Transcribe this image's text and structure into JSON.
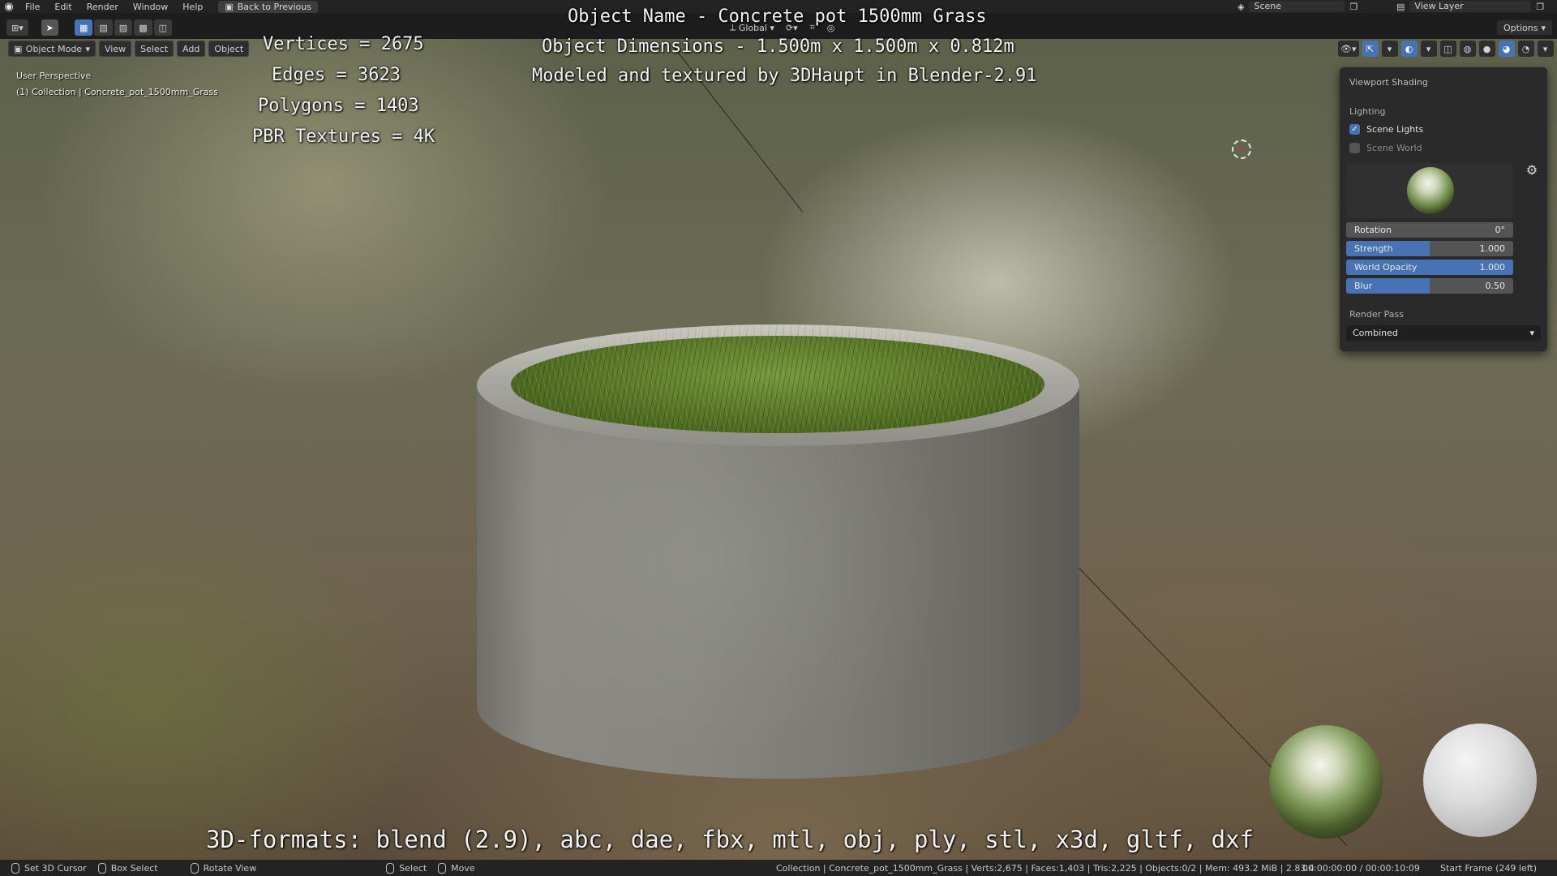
{
  "header": {
    "menu": [
      "File",
      "Edit",
      "Render",
      "Window",
      "Help"
    ],
    "back_button": "Back to Previous",
    "scene_label": "Scene",
    "view_layer_label": "View Layer",
    "options_label": "Options"
  },
  "viewport_header": {
    "mode": "Object Mode",
    "menus": [
      "View",
      "Select",
      "Add",
      "Object"
    ],
    "orientation": "Global"
  },
  "viewport": {
    "perspective": "User Perspective",
    "collection_info": "(1) Collection | Concrete_pot_1500mm_Grass"
  },
  "overlay": {
    "vertices": "Vertices = 2675",
    "edges": "Edges = 3623",
    "polygons": "Polygons = 1403",
    "textures": "PBR Textures = 4K",
    "object_name": "Object Name - Concrete pot 1500mm Grass",
    "dimensions": "Object Dimensions -  1.500m x 1.500m x 0.812m",
    "credits": "Modeled and textured by 3DHaupt in Blender-2.91",
    "formats": "3D-formats: blend (2.9), abc, dae, fbx, mtl, obj, ply, stl, x3d, gltf, dxf"
  },
  "shading_popover": {
    "title": "Viewport Shading",
    "lighting_label": "Lighting",
    "scene_lights": {
      "label": "Scene Lights",
      "checked": true
    },
    "scene_world": {
      "label": "Scene World",
      "checked": false
    },
    "rotation": {
      "label": "Rotation",
      "value": "0°",
      "fill": 0
    },
    "strength": {
      "label": "Strength",
      "value": "1.000",
      "fill": 0.5
    },
    "world_opacity": {
      "label": "World Opacity",
      "value": "1.000",
      "fill": 1
    },
    "blur": {
      "label": "Blur",
      "value": "0.50",
      "fill": 0.5
    },
    "render_pass_label": "Render Pass",
    "render_pass_value": "Combined"
  },
  "statusbar": {
    "set_cursor": "Set 3D Cursor",
    "box_select": "Box Select",
    "rotate_view": "Rotate View",
    "select": "Select",
    "move": "Move",
    "stats": "Collection | Concrete_pot_1500mm_Grass | Verts:2,675 | Faces:1,403 | Tris:2,225 | Objects:0/2 | Mem: 493.2 MiB | 2.83.4",
    "time": "00:00:00:00 / 00:00:10:09",
    "frame": "Start Frame (249 left)"
  },
  "colors": {
    "accent": "#4772b3",
    "panel": "#2a2a2a",
    "header": "#232323"
  }
}
